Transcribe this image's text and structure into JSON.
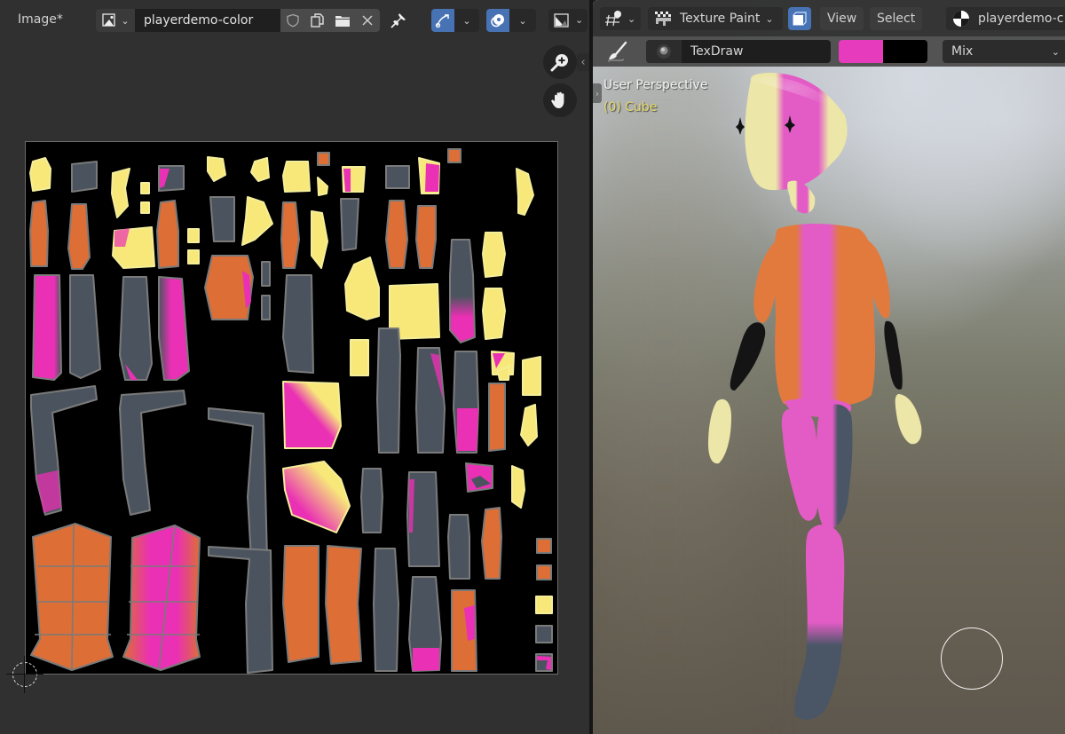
{
  "image_editor": {
    "title": "Image*",
    "image_name": "playerdemo-color",
    "icons": {
      "image_type": "image-icon",
      "fake_user": "shield-icon",
      "duplicate": "duplicate-icon",
      "open": "folder-icon",
      "unlink": "close-icon",
      "pin": "pin-icon",
      "uv_sync": "uv-sync-icon",
      "display_channels": "color-channels-icon",
      "image_display": "image-display-icon"
    },
    "navigation": {
      "zoom": "zoom-in-icon",
      "pan": "hand-icon"
    },
    "uv_colors": {
      "yellow": "#f7e879",
      "orange": "#dd6e36",
      "slate": "#4b545e",
      "magenta": "#ea30b4",
      "edge": "#7a7a7a",
      "selected_edge": "#f5ee9a",
      "background": "#000000"
    }
  },
  "viewport": {
    "editor_type_icon": "object-mode-paint-icon",
    "mode_label": "Texture Paint",
    "mode_icon": "checker-brush-icon",
    "mask_icon": "face-mask-icon",
    "menus": [
      "View",
      "Select"
    ],
    "material_name": "playerdemo-c",
    "material_icon": "material-sphere-icon",
    "tool_icon": "brush-icon",
    "brush_name": "TexDraw",
    "brush_preview_icon": "brush-preview-icon",
    "primary_color": "#e73bbd",
    "secondary_color": "#000000",
    "blend_mode": "Mix",
    "overlay": {
      "view_label": "User Perspective",
      "object_label": "(0) Cube"
    },
    "character_colors": {
      "cream": "#ece6a8",
      "pink": "#e35cc6",
      "orange": "#e27a3e",
      "black": "#141414",
      "slate": "#4a5666"
    }
  }
}
